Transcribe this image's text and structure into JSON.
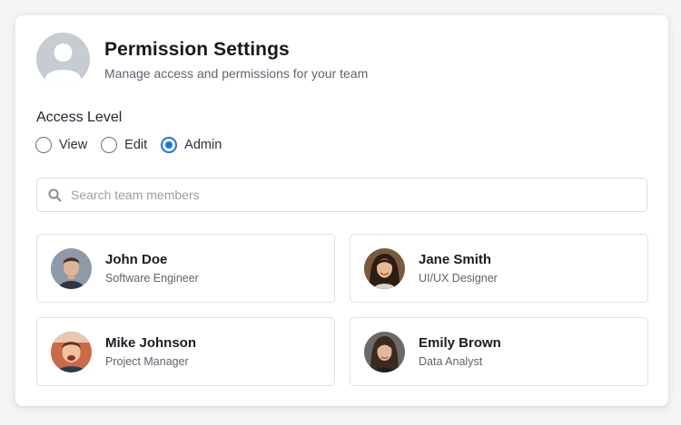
{
  "header": {
    "title": "Permission Settings",
    "subtitle": "Manage access and permissions for your team"
  },
  "access": {
    "label": "Access Level",
    "options": [
      "View",
      "Edit",
      "Admin"
    ],
    "selected": "Admin"
  },
  "search": {
    "placeholder": "Search team members",
    "value": ""
  },
  "members": [
    {
      "name": "John Doe",
      "role": "Software Engineer",
      "avatar_icon": "user-photo"
    },
    {
      "name": "Jane Smith",
      "role": "UI/UX Designer",
      "avatar_icon": "user-photo"
    },
    {
      "name": "Mike Johnson",
      "role": "Project Manager",
      "avatar_icon": "user-photo"
    },
    {
      "name": "Emily Brown",
      "role": "Data Analyst",
      "avatar_icon": "user-photo"
    }
  ],
  "colors": {
    "accent": "#1a73e8",
    "placeholder_avatar": "#c7cbd2"
  }
}
